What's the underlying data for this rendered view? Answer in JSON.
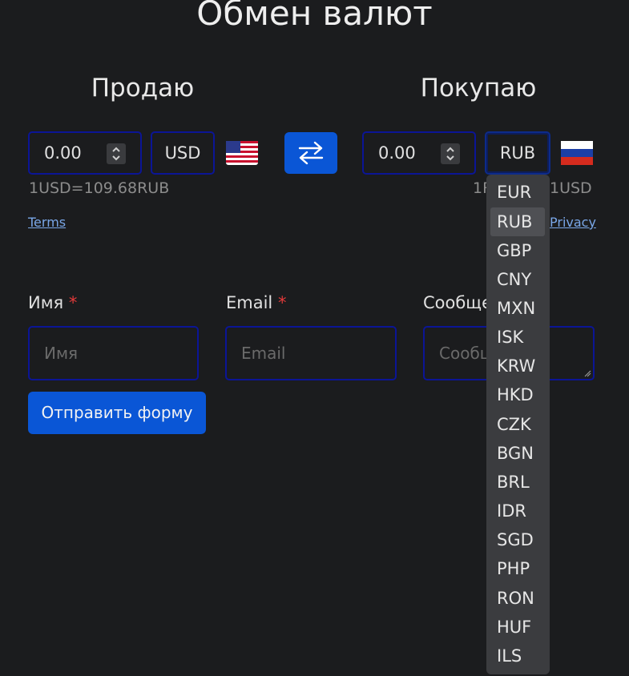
{
  "title": "Обмен валют",
  "sell": {
    "heading": "Продаю",
    "amount": "0.00",
    "currency": "USD",
    "rate": "1USD=109.68RUB",
    "flag": "us-flag-icon"
  },
  "buy": {
    "heading": "Покупаю",
    "amount": "0.00",
    "currency": "RUB",
    "rate_partial_left": "1R",
    "rate_partial_right": "1USD",
    "flag": "ru-flag-icon"
  },
  "swap_icon": "swap-arrows-icon",
  "links": {
    "terms": "Terms",
    "privacy": "Privacy"
  },
  "form": {
    "name_label": "Имя",
    "name_placeholder": "Имя",
    "email_label": "Email",
    "email_placeholder": "Email",
    "message_label": "Сообще",
    "message_placeholder": "Сообщ",
    "required_mark": "*",
    "submit": "Отправить форму"
  },
  "dropdown": {
    "selected": "RUB",
    "options": [
      "EUR",
      "RUB",
      "GBP",
      "CNY",
      "MXN",
      "ISK",
      "KRW",
      "HKD",
      "CZK",
      "BGN",
      "BRL",
      "IDR",
      "SGD",
      "PHP",
      "RON",
      "HUF",
      "ILS"
    ]
  },
  "colors": {
    "background": "#1b1c1e",
    "accent": "#0a56d6",
    "input_border": "#0b1596",
    "required": "#e33a3a",
    "link": "#7aa7e8"
  }
}
